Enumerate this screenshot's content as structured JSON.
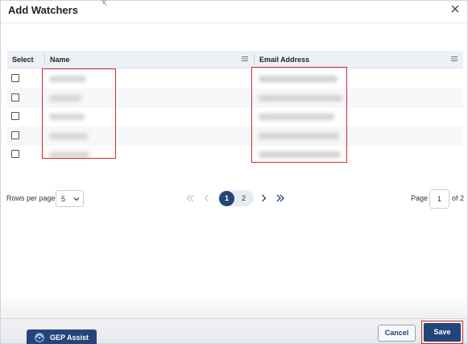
{
  "dialog": {
    "title": "Add Watchers",
    "stray_char": "v̧"
  },
  "grid": {
    "columns": [
      "Select",
      "Name",
      "Email Address"
    ],
    "row_count": 5
  },
  "pagination": {
    "rows_per_page_label": "Rows per page",
    "rows_per_page_value": "5",
    "pages": [
      "1",
      "2"
    ],
    "current_page": "1",
    "page_label": "Page",
    "page_input": "1",
    "of_label": "of 2"
  },
  "footer": {
    "assist_label": "GEP Assist",
    "cancel_label": "Cancel",
    "save_label": "Save"
  },
  "colors": {
    "primary": "#24457a",
    "highlight": "#d42a2a",
    "header_bg": "#eef0f8"
  },
  "icons": {
    "close": "close-icon",
    "column_menu": "menu-icon",
    "first_page": "double-chevron-left-icon",
    "prev_page": "chevron-left-icon",
    "next_page": "chevron-right-icon",
    "last_page": "double-chevron-right-icon",
    "dropdown": "chevron-down-icon",
    "assist": "gep-logo-icon"
  }
}
